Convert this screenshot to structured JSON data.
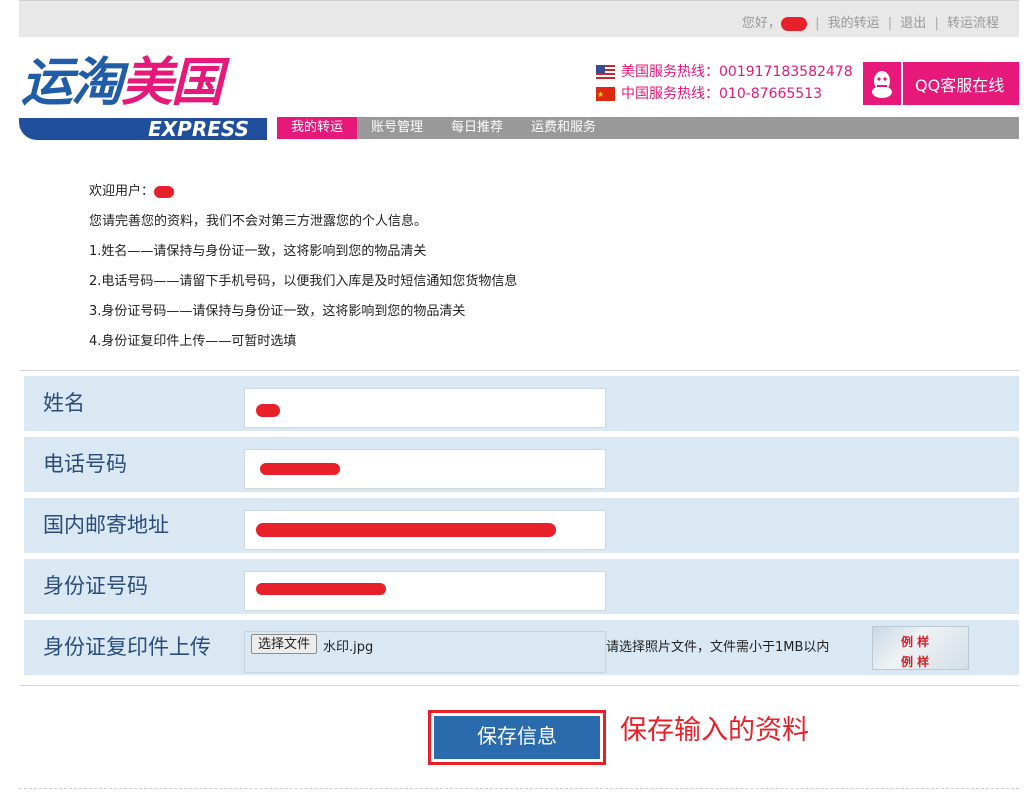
{
  "topnav": {
    "greeting": "您好，",
    "links": [
      "我的转运",
      "退出",
      "转运流程"
    ],
    "separator": "|"
  },
  "logo": {
    "cn_part1": "运淘",
    "cn_part2": "美国",
    "en": "EXPRESS"
  },
  "hotlines": [
    {
      "flag": "us-flag-icon",
      "text": "美国服务热线：001917183582478"
    },
    {
      "flag": "cn-flag-icon",
      "text": "中国服务热线：010-87665513"
    }
  ],
  "qq": {
    "label": "QQ客服在线",
    "icon": "qq-penguin-icon"
  },
  "nav": {
    "tabs": [
      "我的转运",
      "账号管理",
      "每日推荐",
      "运费和服务"
    ],
    "active_index": 0
  },
  "intro": {
    "welcome": "欢迎用户：",
    "lines": [
      "您请完善您的资料，我们不会对第三方泄露您的个人信息。",
      "1.姓名——请保持与身份证一致，这将影响到您的物品清关",
      "2.电话号码——请留下手机号码，以便我们入库是及时短信通知您货物信息",
      "3.身份证号码——请保持与身份证一致，这将影响到您的物品清关",
      "4.身份证复印件上传——可暂时选填"
    ]
  },
  "form": {
    "name_label": "姓名",
    "name_value": "",
    "phone_label": "电话号码",
    "phone_value": "",
    "address_label": "国内邮寄地址",
    "address_value": "",
    "idno_label": "身份证号码",
    "idno_value": "",
    "upload_label": "身份证复印件上传",
    "file_button": "选择文件",
    "file_name": "水印.jpg",
    "upload_hint": "请选择照片文件，文件需小于1MB以内"
  },
  "save_button": "保存信息",
  "annotation": "保存输入的资料",
  "colors": {
    "brand_pink": "#e6197a",
    "brand_blue": "#1f4f9c",
    "form_row_bg": "#d9e8f3",
    "button_blue": "#2a6bae",
    "annotation_red": "#e8202a"
  }
}
